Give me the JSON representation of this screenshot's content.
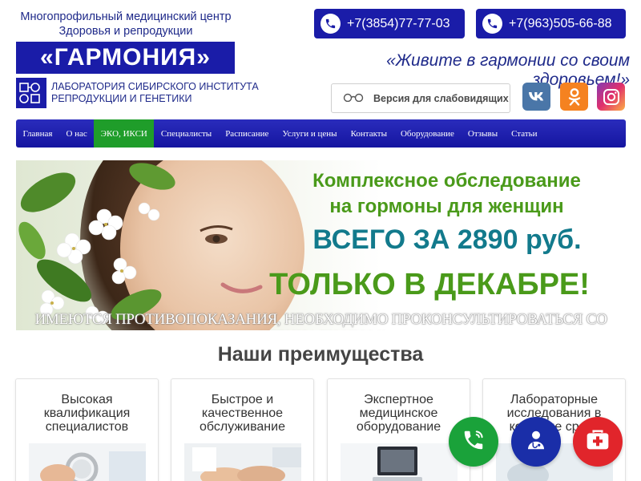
{
  "header": {
    "brand_line1": "Многопрофильный медицинский центр",
    "brand_line2": "Здоровья и репродукции",
    "brand_name": "«ГАРМОНИЯ»",
    "lab_line1": "ЛАБОРАТОРИЯ СИБИРСКОГО ИНСТИТУТА",
    "lab_line2": "РЕПРОДУКЦИИ И ГЕНЕТИКИ",
    "phone1": "+7(3854)77-77-03",
    "phone2": "+7(963)505-66-88",
    "slogan": "«Живите в гармонии со своим здоровьем!»",
    "vision_label": "Версия для слабовидящих",
    "social": {
      "vk": "vk",
      "ok": "ok",
      "instagram": "instagram"
    }
  },
  "nav": {
    "items": [
      {
        "label": "Главная"
      },
      {
        "label": "О нас"
      },
      {
        "label": "ЭКО, ИКСИ"
      },
      {
        "label": "Специалисты"
      },
      {
        "label": "Расписание"
      },
      {
        "label": "Услуги и цены"
      },
      {
        "label": "Контакты"
      },
      {
        "label": "Оборудование"
      },
      {
        "label": "Отзывы"
      },
      {
        "label": "Статьи"
      }
    ],
    "active_index": 2,
    "active_color": "#1f9d2a",
    "bar_color": "#1a1ca8"
  },
  "banner": {
    "line1a": "Комплексное обследование",
    "line1b": "на гормоны для женщин",
    "line2": "ВСЕГО ЗА 2890 руб.",
    "line3": "ТОЛЬКО В ДЕКАБРЕ!",
    "disclaimer": "ИМЕЮТСЯ ПРОТИВОПОКАЗАНИЯ, НЕОБХОДИМО ПРОКОНСУЛЬТИРОВАТЬСЯ СО СПЕЦИАЛИСТОМ!"
  },
  "advantages": {
    "title": "Наши преимущества",
    "cards": [
      {
        "title": "Высокая квалификация специалистов"
      },
      {
        "title": "Быстрое и качественное обслуживание"
      },
      {
        "title": "Экспертное медицинское оборудование"
      },
      {
        "title": "Лабораторные исследования в короткие сроки"
      }
    ]
  },
  "floating": {
    "call_icon": "phone-icon",
    "doctor_icon": "doctor-icon",
    "firstaid_icon": "first-aid-icon"
  },
  "colors": {
    "brand_blue": "#1a1ca8",
    "accent_green": "#1f9d2a",
    "call_green": "#1aa23a",
    "aid_red": "#e1252b"
  }
}
